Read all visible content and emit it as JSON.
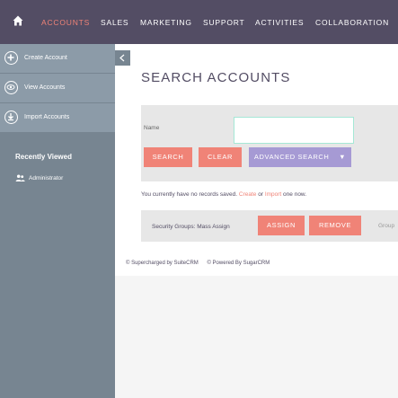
{
  "nav": {
    "items": [
      "ACCOUNTS",
      "SALES",
      "MARKETING",
      "SUPPORT",
      "ACTIVITIES",
      "COLLABORATION"
    ],
    "active_index": 0
  },
  "sidebar": {
    "actions": [
      {
        "label": "Create Account",
        "icon": "plus-circle-icon"
      },
      {
        "label": "View Accounts",
        "icon": "eye-circle-icon"
      },
      {
        "label": "Import Accounts",
        "icon": "import-circle-icon"
      }
    ],
    "recently_viewed_title": "Recently Viewed",
    "recent_items": [
      {
        "label": "Administrator",
        "icon": "users-icon"
      }
    ]
  },
  "main": {
    "title": "SEARCH ACCOUNTS",
    "search": {
      "name_label": "Name",
      "name_value": "",
      "search_label": "SEARCH",
      "clear_label": "CLEAR",
      "advanced_label": "ADVANCED SEARCH",
      "advanced_caret": "▼"
    },
    "no_records": {
      "prefix": "You currently have no records saved.",
      "create": "Create",
      "or": "or",
      "import": "Import",
      "suffix": "one now."
    },
    "mass_assign": {
      "label": "Security Groups: Mass Assign",
      "assign": "ASSIGN",
      "remove": "REMOVE",
      "group": "Group"
    }
  },
  "footer": {
    "supercharged": "© Supercharged by SuiteCRM",
    "powered": "© Powered By SugarCRM"
  },
  "colors": {
    "nav_bg": "#534d64",
    "accent": "#f08377",
    "advanced": "#a69ad4",
    "sidebar_bg": "#778591",
    "sidebar_action_bg": "#8c9ba8"
  }
}
